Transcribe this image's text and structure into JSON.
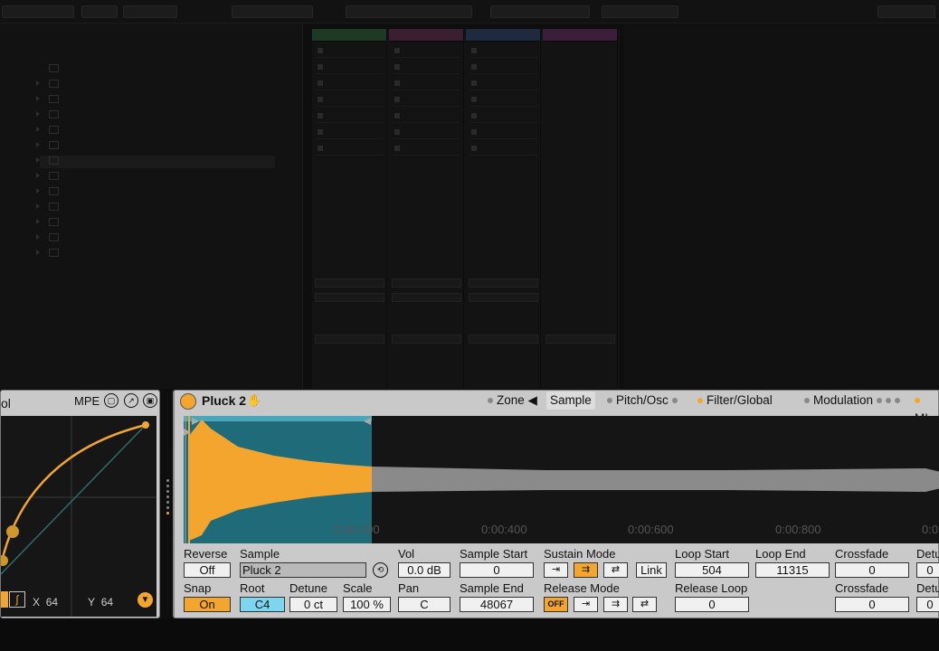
{
  "mpe_panel": {
    "title": "ol",
    "mpe_label": "MPE",
    "x_label": "X",
    "x_value": "64",
    "y_label": "Y",
    "y_value": "64"
  },
  "sampler": {
    "device_name": "Pluck 2",
    "tabs": [
      {
        "label": "Zone ◀",
        "selected": false
      },
      {
        "label": "Sample",
        "selected": true
      },
      {
        "label": "Pitch/Osc",
        "selected": false
      },
      {
        "label": "Filter/Global",
        "selected": false
      },
      {
        "label": "Modulation",
        "selected": false
      },
      {
        "label": "MI",
        "selected": false
      }
    ],
    "timeline": [
      "0:00:200",
      "0:00:400",
      "0:00:600",
      "0:00:800",
      "0:0"
    ],
    "reverse": {
      "label": "Reverse",
      "value": "Off"
    },
    "snap": {
      "label": "Snap",
      "value": "On"
    },
    "sample": {
      "label": "Sample",
      "value": "Pluck 2"
    },
    "root": {
      "label": "Root",
      "value": "C4"
    },
    "detune": {
      "label": "Detune",
      "value": "0 ct"
    },
    "scale": {
      "label": "Scale",
      "value": "100 %"
    },
    "vol": {
      "label": "Vol",
      "value": "0.0 dB"
    },
    "pan": {
      "label": "Pan",
      "value": "C"
    },
    "sample_start": {
      "label": "Sample Start",
      "value": "0"
    },
    "sample_end": {
      "label": "Sample End",
      "value": "48067"
    },
    "sustain_mode": {
      "label": "Sustain Mode",
      "link": "Link"
    },
    "release_mode": {
      "label": "Release Mode",
      "off": "OFF"
    },
    "loop_start": {
      "label": "Loop Start",
      "value": "504"
    },
    "loop_end": {
      "label": "Loop End",
      "value": "11315"
    },
    "release_loop": {
      "label": "Release Loop",
      "value": "0"
    },
    "crossfade1": {
      "label": "Crossfade",
      "value": "0"
    },
    "crossfade2": {
      "label": "Crossfade",
      "value": "0"
    },
    "detune_r1": {
      "label": "Detu",
      "value": "0"
    },
    "detune_r2": {
      "label": "Detu",
      "value": "0"
    }
  },
  "colors": {
    "accent": "#f3a52e",
    "panel": "#c9c9c9",
    "wave_bg": "#151515",
    "loop_region": "#1f6b7a"
  }
}
